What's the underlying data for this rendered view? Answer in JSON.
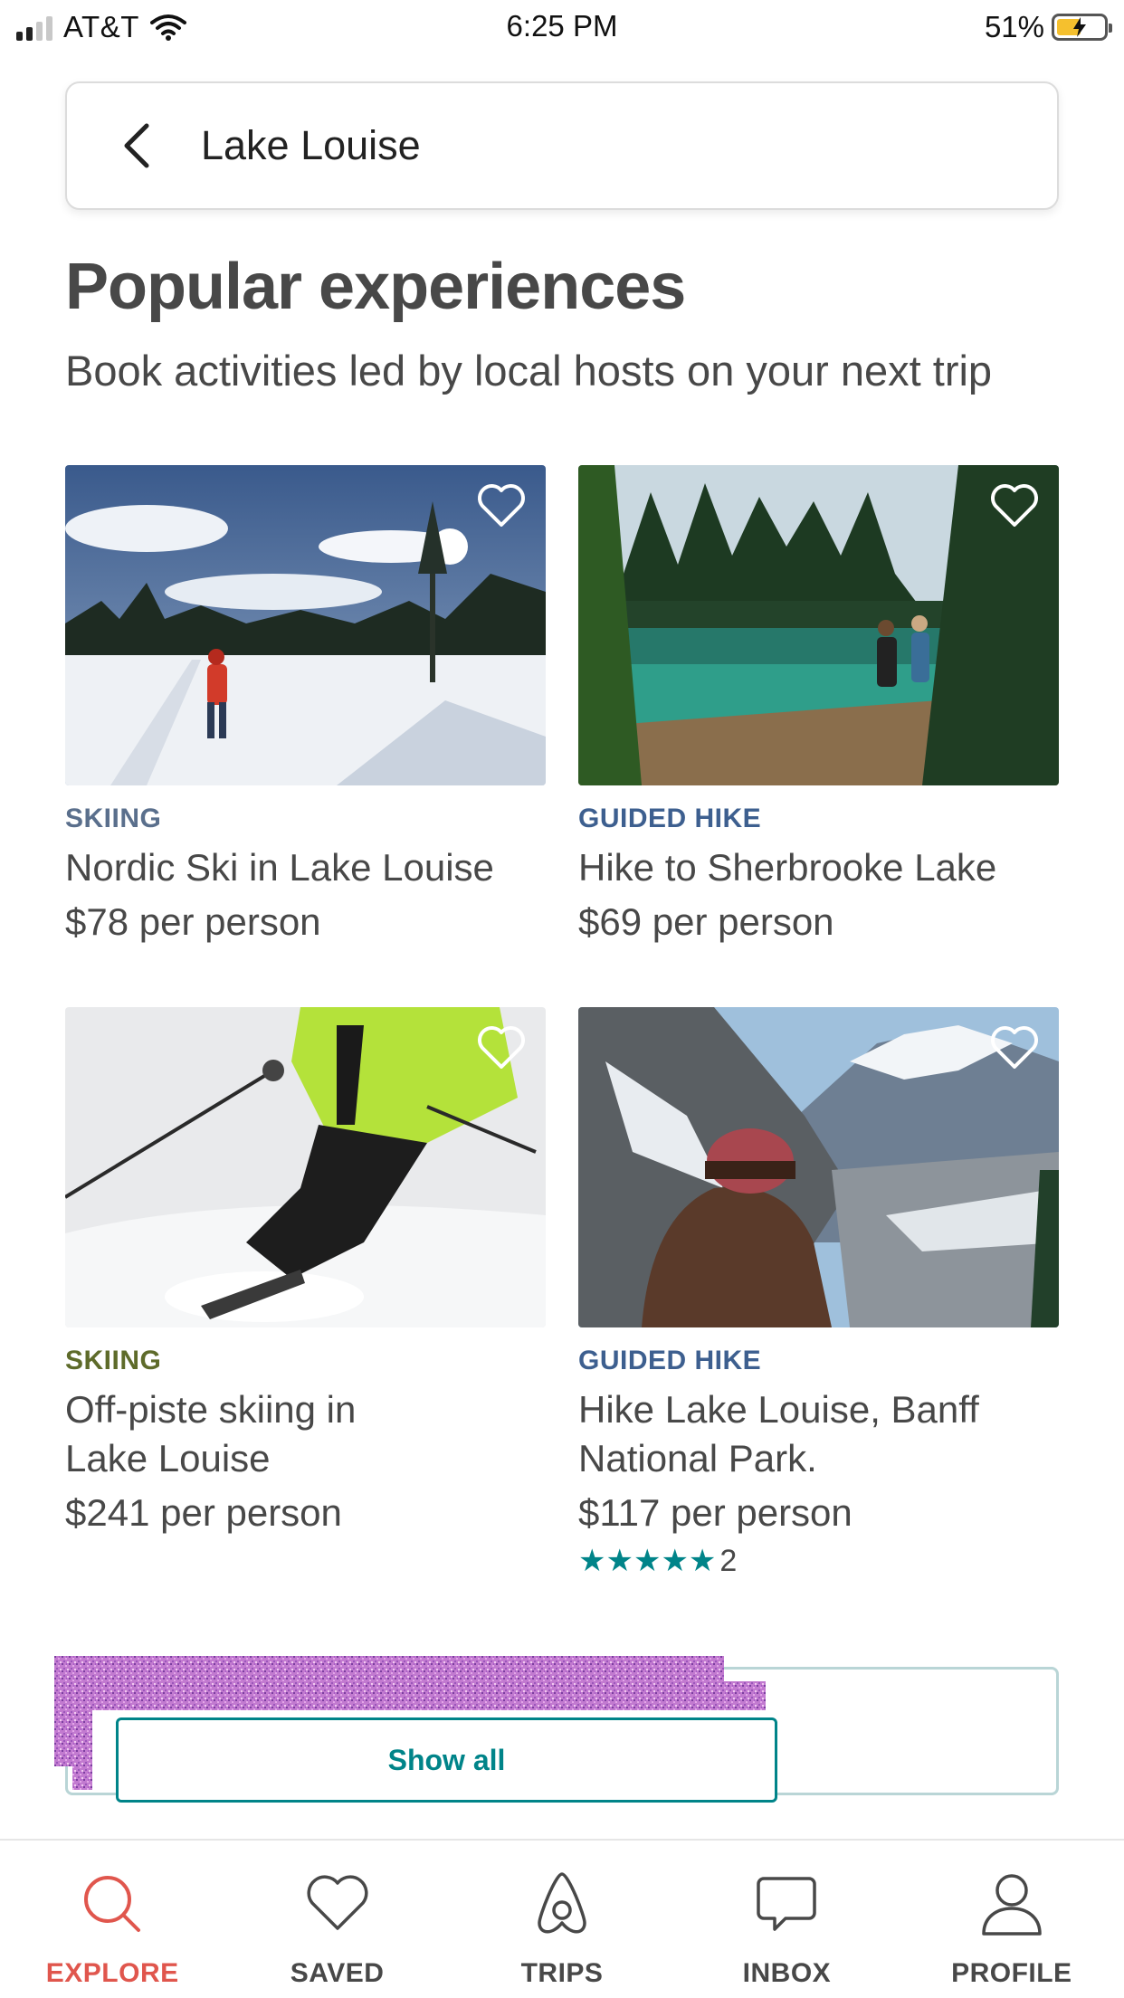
{
  "status_bar": {
    "carrier": "AT&T",
    "time": "6:25 PM",
    "battery_percent": "51%",
    "battery_level": 0.51,
    "signal_bars": 2
  },
  "search": {
    "query": "Lake Louise",
    "back_icon": "chevron-left-icon"
  },
  "header": {
    "title": "Popular experiences",
    "subtitle": "Book activities led by local hosts on your next trip"
  },
  "cards": [
    {
      "category": "SKIING",
      "category_color": "#5a6f8c",
      "title_line1": "Nordic Ski in Lake Louise",
      "title_line2": "",
      "price": "$78 per person"
    },
    {
      "category": "GUIDED HIKE",
      "category_color": "#3d5f8f",
      "title_line1": "Hike to Sherbrooke Lake",
      "title_line2": "",
      "price": "$69 per person"
    },
    {
      "category": "SKIING",
      "category_color": "#5e6b2a",
      "title_line1": "Off-piste skiing in",
      "title_line2": "Lake Louise",
      "price": "$241 per person"
    },
    {
      "category": "GUIDED HIKE",
      "category_color": "#3d5f8f",
      "title_line1": "Hike Lake Louise, Banff",
      "title_line2": "National Park.",
      "price": "$117 per person",
      "stars": "★★★★★",
      "rating_value": 5,
      "review_count": "2"
    }
  ],
  "show_all_label": "Show all",
  "tabs": [
    {
      "label": "EXPLORE",
      "icon": "search-icon",
      "active": true
    },
    {
      "label": "SAVED",
      "icon": "heart-icon",
      "active": false
    },
    {
      "label": "TRIPS",
      "icon": "airbnb-logo-icon",
      "active": false
    },
    {
      "label": "INBOX",
      "icon": "message-icon",
      "active": false
    },
    {
      "label": "PROFILE",
      "icon": "user-icon",
      "active": false
    }
  ],
  "colors": {
    "accent": "#e0564d",
    "teal": "#008489",
    "text": "#484848"
  }
}
